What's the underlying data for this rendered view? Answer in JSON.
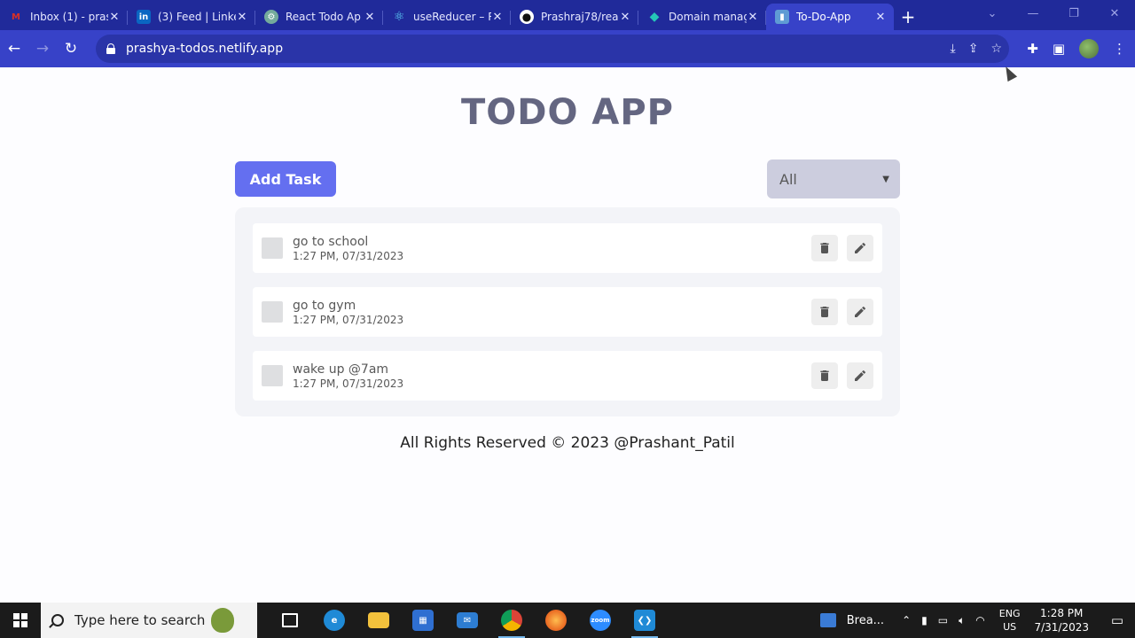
{
  "browser": {
    "tabs": [
      {
        "title": "Inbox (1) - pras",
        "favicon": "gmail-icon",
        "color": "#d93025",
        "glyph": "M"
      },
      {
        "title": "(3) Feed | Linke",
        "favicon": "linkedin-icon",
        "color": "#0a66c2",
        "glyph": "in"
      },
      {
        "title": "React Todo Ap",
        "favicon": "chatgpt-icon",
        "color": "#74aa9c",
        "glyph": "⚙"
      },
      {
        "title": "useReducer – R",
        "favicon": "react-icon",
        "color": "#2a34a8",
        "glyph": "⚛"
      },
      {
        "title": "Prashraj78/rea",
        "favicon": "github-icon",
        "color": "#111111",
        "glyph": "●"
      },
      {
        "title": "Domain manag",
        "favicon": "netlify-icon",
        "color": "#25c7b7",
        "glyph": "◆"
      },
      {
        "title": "To-Do-App",
        "favicon": "page-icon",
        "color": "#5f9bd4",
        "glyph": "▮",
        "active": true
      }
    ],
    "new_tab": "+",
    "url": "prashya-todos.netlify.app"
  },
  "app": {
    "title": "TODO APP",
    "add_button": "Add Task",
    "filter": {
      "selected": "All"
    },
    "todos": [
      {
        "title": "go to school",
        "time": "1:27 PM, 07/31/2023"
      },
      {
        "title": "go to gym",
        "time": "1:27 PM, 07/31/2023"
      },
      {
        "title": "wake up @7am",
        "time": "1:27 PM, 07/31/2023"
      }
    ],
    "footer": "All Rights Reserved © 2023 @Prashant_Patil"
  },
  "taskbar": {
    "search_placeholder": "Type here to search",
    "news": "Brea...",
    "language": "ENG",
    "region": "US",
    "time": "1:28 PM",
    "date": "7/31/2023"
  }
}
